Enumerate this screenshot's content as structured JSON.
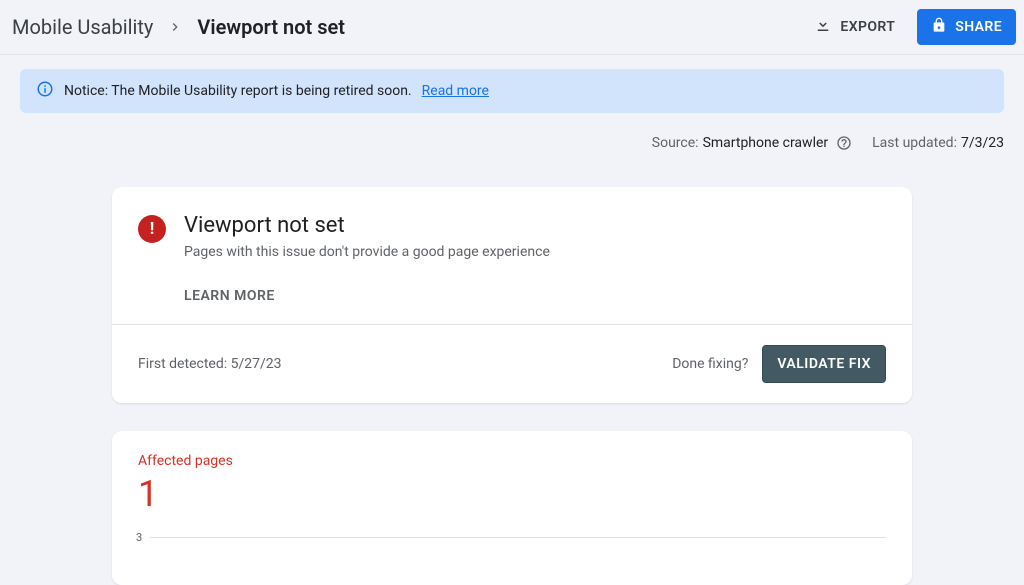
{
  "header": {
    "breadcrumb_parent": "Mobile Usability",
    "breadcrumb_current": "Viewport not set",
    "export_label": "EXPORT",
    "share_label": "SHARE"
  },
  "notice": {
    "text": "Notice: The Mobile Usability report is being retired soon. ",
    "link_text": "Read more"
  },
  "meta": {
    "source_label": "Source:",
    "source_value": "Smartphone crawler",
    "updated_label": "Last updated:",
    "updated_value": "7/3/23"
  },
  "issue": {
    "title": "Viewport not set",
    "subtitle": "Pages with this issue don't provide a good page experience",
    "learn_more": "LEARN MORE",
    "first_detected_label": "First detected: ",
    "first_detected_value": "5/27/23",
    "done_fixing": "Done fixing?",
    "validate_label": "VALIDATE FIX"
  },
  "affected": {
    "label": "Affected pages",
    "count": "1"
  },
  "chart_data": {
    "type": "line",
    "title": "",
    "xlabel": "",
    "ylabel": "",
    "y_ticks": [
      3
    ],
    "series": [
      {
        "name": "Affected pages",
        "values": []
      }
    ]
  }
}
